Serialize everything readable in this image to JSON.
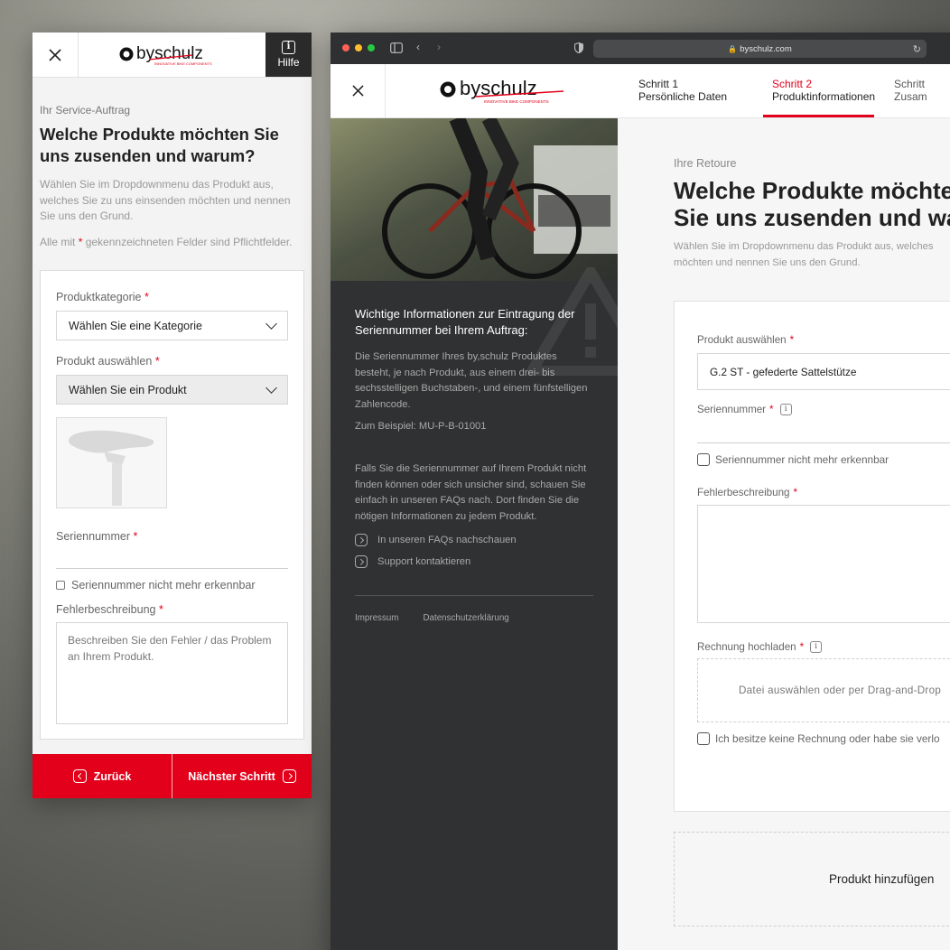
{
  "brand": {
    "accent": "#e2001a",
    "logo_text": "byschulz",
    "logo_tagline": "INNOVATIVE BIKE COMPONENTS"
  },
  "mobile": {
    "help_label": "Hilfe",
    "eyebrow": "Ihr Service-Auftrag",
    "title": "Welche Produkte möchten Sie uns zusenden und warum?",
    "description": "Wählen Sie im Dropdownmenu das Produkt aus, welches Sie zu uns einsenden möchten und nennen Sie uns den Grund.",
    "required_prefix": "Alle mit",
    "required_star": "*",
    "required_suffix": "gekennzeichneten Felder sind Pflichtfelder.",
    "category_label": "Produktkategorie",
    "category_value": "Wählen Sie eine Kategorie",
    "product_label": "Produkt auswählen",
    "product_value": "Wählen Sie ein Produkt",
    "serial_label": "Seriennummer",
    "serial_checkbox": "Seriennummer nicht mehr erkennbar",
    "error_label": "Fehlerbeschreibung",
    "error_placeholder": "Beschreiben Sie den Fehler / das Problem an Ihrem Produkt.",
    "back_button": "Zurück",
    "next_button": "Nächster Schritt"
  },
  "browser": {
    "url": "byschulz.com",
    "steps": [
      {
        "number": "Schritt 1",
        "label": "Persönliche Daten"
      },
      {
        "number": "Schritt 2",
        "label": "Produktinformationen"
      },
      {
        "number": "Schritt",
        "label": "Zusam"
      }
    ],
    "info": {
      "title": "Wichtige Informationen zur Eintragung der Seriennummer bei Ihrem Auftrag:",
      "p1": "Die Seriennummer Ihres by,schulz Produktes besteht, je nach Produkt, aus einem drei- bis sechsstelligen Buchstaben-, und einem fünfstelligen Zahlencode.",
      "p2": "Zum Beispiel: MU-P-B-01001",
      "p3": "Falls Sie die Seriennummer auf Ihrem Produkt nicht finden können oder sich unsicher sind, schauen Sie einfach in unseren FAQs nach. Dort finden Sie die nötigen Informationen zu jedem Produkt.",
      "link_faq": "In unseren FAQs nachschauen",
      "link_support": "Support kontaktieren",
      "footer_impressum": "Impressum",
      "footer_datenschutz": "Datenschutzerklärung"
    },
    "form": {
      "eyebrow": "Ihre Retoure",
      "title_line1": "Welche Produkte möchte",
      "title_line2": "Sie uns zusenden und wa",
      "desc_line1": "Wählen Sie im Dropdownmenu das Produkt aus, welches",
      "desc_line2": "möchten und nennen Sie uns den Grund.",
      "product_label": "Produkt auswählen",
      "product_value": "G.2 ST - gefederte Sattelstütze",
      "serial_label": "Seriennummer",
      "serial_checkbox": "Seriennummer nicht mehr erkennbar",
      "error_label": "Fehlerbeschreibung",
      "invoice_label": "Rechnung hochladen",
      "dropzone": "Datei auswählen oder per Drag-and-Drop",
      "invoice_checkbox": "Ich besitze keine Rechnung oder habe sie verlo",
      "add_product": "Produkt hinzufügen"
    }
  }
}
